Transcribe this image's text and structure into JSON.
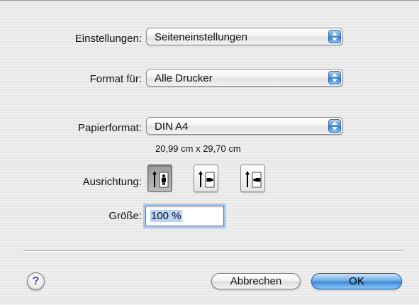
{
  "settings": {
    "label": "Einstellungen:",
    "value": "Seiteneinstellungen"
  },
  "format_for": {
    "label": "Format für:",
    "value": "Alle Drucker"
  },
  "paper": {
    "label": "Papierformat:",
    "value": "DIN A4",
    "size_text": "20,99 cm x 29,70 cm"
  },
  "orientation": {
    "label": "Ausrichtung:",
    "options": [
      {
        "name": "portrait",
        "icon": "portrait-orientation-icon",
        "selected": true
      },
      {
        "name": "landscape",
        "icon": "landscape-orientation-icon",
        "selected": false
      },
      {
        "name": "reverse-landscape",
        "icon": "reverse-landscape-orientation-icon",
        "selected": false
      }
    ]
  },
  "scale": {
    "label": "Größe:",
    "value": "100 %"
  },
  "buttons": {
    "help": "?",
    "cancel": "Abbrechen",
    "ok": "OK"
  },
  "colors": {
    "accent": "#3d8ad8",
    "help_icon": "#7b2bb8"
  }
}
